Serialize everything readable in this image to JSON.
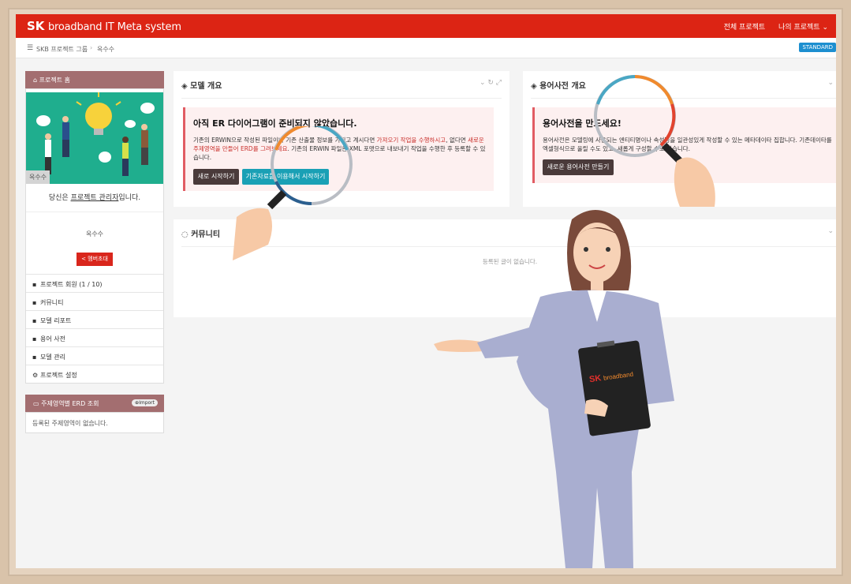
{
  "app": {
    "brand_sk": "SK",
    "brand_rest": "broadband IT Meta system",
    "nav_all_projects": "전체 프로젝트",
    "nav_my_projects": "나의 프로젝트 ⌄"
  },
  "breadcrumb": {
    "group": "SKB 프로젝트 그룹",
    "separator": "›",
    "current": "옥수수",
    "badge": "STANDARD"
  },
  "sidebar": {
    "header": "프로젝트 홈",
    "hero_label": "옥수수",
    "owner_prefix": "당신은 ",
    "owner_role": "프로젝트 관리자",
    "owner_suffix": "입니다.",
    "project_name": "옥수수",
    "invite_button": "멤버초대",
    "menu": [
      {
        "icon": "users-icon",
        "label": "프로젝트 회원 (1 / 10)"
      },
      {
        "icon": "comments-icon",
        "label": "커뮤니티"
      },
      {
        "icon": "report-icon",
        "label": "모델 리포트"
      },
      {
        "icon": "book-icon",
        "label": "용어 사전"
      },
      {
        "icon": "database-icon",
        "label": "모델 관리"
      },
      {
        "icon": "gear-icon",
        "label": "프로젝트 설정"
      }
    ],
    "erd": {
      "header": "주제영역별 ERD 조회",
      "import_label": "Import",
      "empty": "등록된 주제영역이 없습니다."
    }
  },
  "model_panel": {
    "title": "모델 개요",
    "alert_title": "아직 ER 다이어그램이 준비되지 않았습니다.",
    "text_1": "기존의 ERWIN으로 작성된 파일이나 기존 산출물 정보를 가지고 계시다면 ",
    "text_link1": "가져오기 작업을 수행하시고",
    "text_2": ", 없다면 ",
    "text_link2_a": "새로운",
    "text_link2_b": "주제영역을 만들어 ERD를 그려보세요",
    "text_3": ". 기존의 ERWIN 파일은 XML 포맷으로 내보내기 작업을 수행한 후 등록할 수 있",
    "text_4": "습니다.",
    "btn_new": "새로 시작하기",
    "btn_existing": "기존자료를 이용해서 시작하기"
  },
  "glossary_panel": {
    "title": "용어사전 개요",
    "alert_title": "용어사전을 만드세요!",
    "text_1": "용어사전은 모델링에 사용되는 엔티티명이나 속성명을 일관성있게 작성할 수 있는 메타데이타 집합니다. 기존데이타를",
    "text_2": "엑셀형식으로 올릴 수도 있고, 새롭게 구성할 수도 있습니다.",
    "btn_create": "새로운 용어사전 만들기"
  },
  "community_panel": {
    "title": "커뮤니티",
    "empty": "등록된 글이 없습니다."
  },
  "illustration": {
    "clipboard_sk": "SK",
    "clipboard_brand": "broadband"
  },
  "colors": {
    "topbar": "#dc2414",
    "sidebar_header": "#a36e70",
    "alert_border": "#e15c63",
    "teal_button": "#1aa0b5",
    "dark_button": "#4a3a3a",
    "standard_badge": "#1d8fd0"
  }
}
